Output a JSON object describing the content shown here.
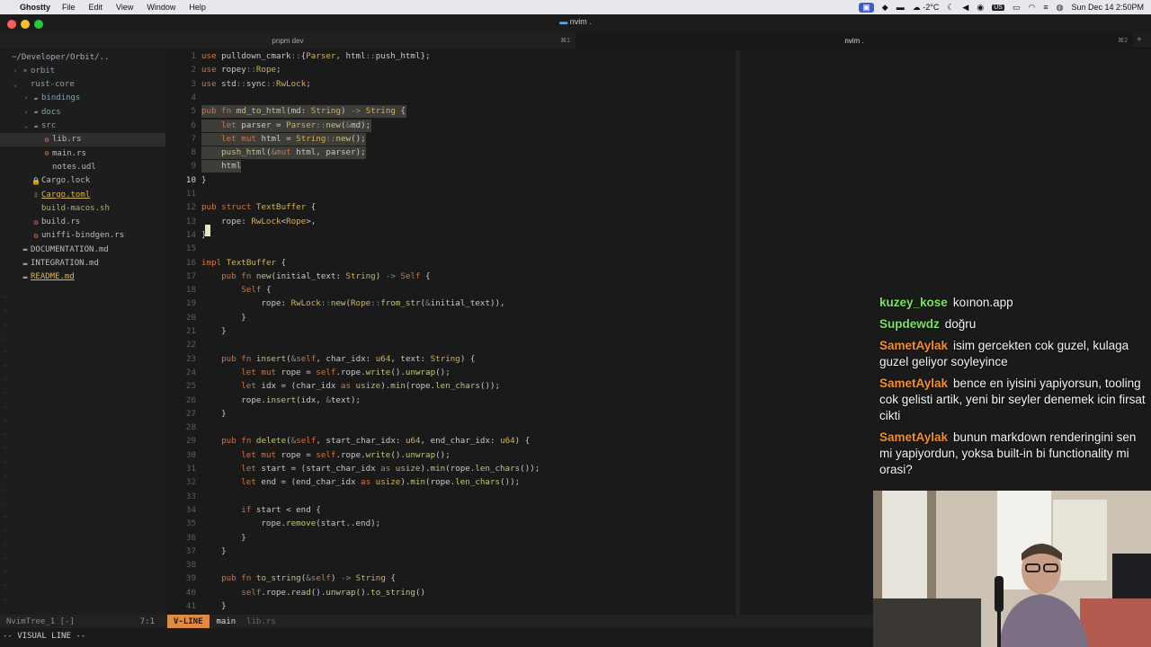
{
  "menubar": {
    "app_name": "Ghostty",
    "items": [
      "File",
      "Edit",
      "View",
      "Window",
      "Help"
    ],
    "weather": "-2°C",
    "keyboard": "US",
    "datetime": "Sun Dec 14  2:50PM"
  },
  "window": {
    "title": "nvim .",
    "tabs": [
      {
        "label": "pnpm dev",
        "shortcut": "⌘1"
      },
      {
        "label": "nvim .",
        "shortcut": "⌘2"
      }
    ],
    "new_tab": "+"
  },
  "tree": {
    "root": "~/Developer/Orbit/..",
    "rows": [
      {
        "arrow": "›",
        "icon": "×",
        "name": "orbit",
        "kind": "dir",
        "indent": 0
      },
      {
        "arrow": "⌄",
        "icon": "",
        "name": "rust-core",
        "kind": "dir",
        "indent": 0
      },
      {
        "arrow": "›",
        "icon": "▰",
        "name": "bindings",
        "kind": "dir",
        "indent": 1
      },
      {
        "arrow": "›",
        "icon": "▰",
        "name": "docs",
        "kind": "dir",
        "indent": 1
      },
      {
        "arrow": "⌄",
        "icon": "▰",
        "name": "src",
        "kind": "dir",
        "indent": 1
      },
      {
        "arrow": "",
        "icon": "⚙",
        "name": "lib.rs",
        "kind": "file",
        "indent": 2
      },
      {
        "arrow": "",
        "icon": "⚙",
        "name": "main.rs",
        "kind": "file",
        "indent": 2
      },
      {
        "arrow": "",
        "icon": "",
        "name": "notes.udl",
        "kind": "file",
        "indent": 2
      },
      {
        "arrow": "",
        "icon": "🔒",
        "name": "Cargo.lock",
        "kind": "file",
        "indent": 1
      },
      {
        "arrow": "",
        "icon": "▯",
        "name": "Cargo.toml",
        "kind": "mod",
        "indent": 1
      },
      {
        "arrow": "",
        "icon": "",
        "name": "build-macos.sh",
        "kind": "exe",
        "indent": 1
      },
      {
        "arrow": "",
        "icon": "⚙",
        "name": "build.rs",
        "kind": "file",
        "indent": 1
      },
      {
        "arrow": "",
        "icon": "⚙",
        "name": "uniffi-bindgen.rs",
        "kind": "file",
        "indent": 1
      },
      {
        "arrow": "",
        "icon": "▬",
        "name": "DOCUMENTATION.md",
        "kind": "file",
        "indent": 0
      },
      {
        "arrow": "",
        "icon": "▬",
        "name": "INTEGRATION.md",
        "kind": "file",
        "indent": 0
      },
      {
        "arrow": "",
        "icon": "▬",
        "name": "README.md",
        "kind": "mod",
        "indent": 0
      }
    ]
  },
  "editor": {
    "lines": [
      "use pulldown_cmark::{Parser, html::push_html};",
      "use ropey::Rope;",
      "use std::sync::RwLock;",
      "",
      "pub fn md_to_html(md: String) -> String {",
      "    let parser = Parser::new(&md);",
      "    let mut html = String::new();",
      "    push_html(&mut html, parser);",
      "    html",
      "}",
      "",
      "pub struct TextBuffer {",
      "    rope: RwLock<Rope>,",
      "}",
      "",
      "impl TextBuffer {",
      "    pub fn new(initial_text: String) -> Self {",
      "        Self {",
      "            rope: RwLock::new(Rope::from_str(&initial_text)),",
      "        }",
      "    }",
      "",
      "    pub fn insert(&self, char_idx: u64, text: String) {",
      "        let mut rope = self.rope.write().unwrap();",
      "        let idx = (char_idx as usize).min(rope.len_chars());",
      "        rope.insert(idx, &text);",
      "    }",
      "",
      "    pub fn delete(&self, start_char_idx: u64, end_char_idx: u64) {",
      "        let mut rope = self.rope.write().unwrap();",
      "        let start = (start_char_idx as usize).min(rope.len_chars());",
      "        let end = (end_char_idx as usize).min(rope.len_chars());",
      "",
      "        if start < end {",
      "            rope.remove(start..end);",
      "        }",
      "    }",
      "",
      "    pub fn to_string(&self) -> String {",
      "        self.rope.read().unwrap().to_string()",
      "    }"
    ],
    "selected_lines": [
      5,
      6,
      7,
      8,
      9
    ],
    "cursor_line": 10
  },
  "statusline": {
    "tree_label": "NvimTree_1 [-]",
    "tree_pos": "7:1",
    "mode": "V-LINE",
    "branch": " main",
    "file": "lib.rs",
    "cmdline": "-- VISUAL LINE --"
  },
  "chat": [
    {
      "user": "kuzey_kose",
      "color": "#7be35a",
      "text": "koınon.app"
    },
    {
      "user": "Supdewdz",
      "color": "#7be35a",
      "text": "doğru"
    },
    {
      "user": "SametAylak",
      "color": "#f0902c",
      "text": "isim gercekten cok guzel, kulaga guzel geliyor soyleyince"
    },
    {
      "user": "SametAylak",
      "color": "#f0902c",
      "text": "bence en iyisini yapiyorsun, tooling cok gelisti artik, yeni bir seyler denemek icin firsat cikti"
    },
    {
      "user": "SametAylak",
      "color": "#f0902c",
      "text": "bunun markdown renderingini sen mi yapiyordun, yoksa built-in bi functionality mi orasi?"
    }
  ]
}
